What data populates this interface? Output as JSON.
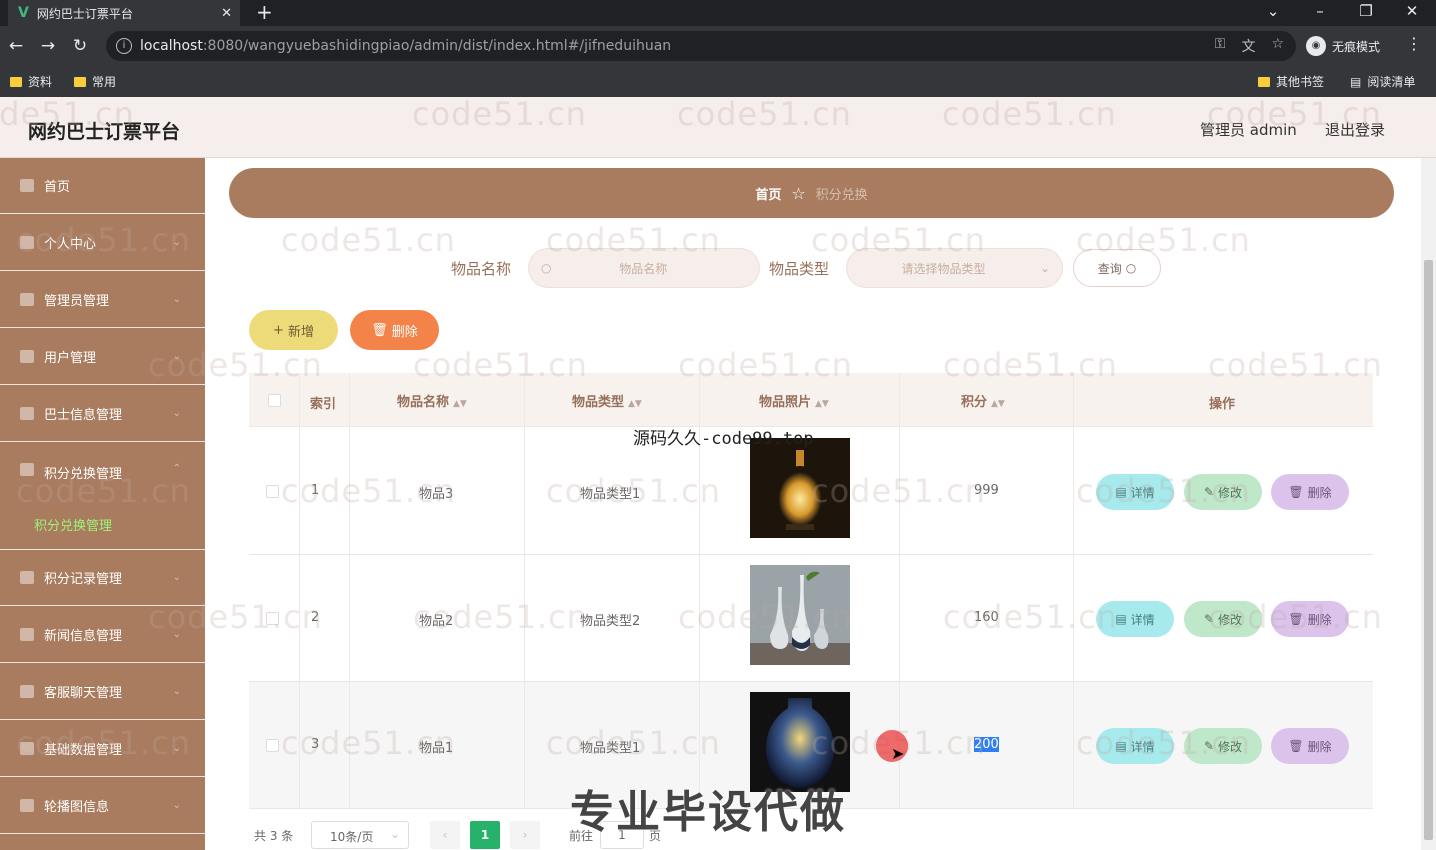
{
  "browser": {
    "tab_title": "网约巴士订票平台",
    "url_host": "localhost",
    "url_path": ":8080/wangyuebashidingpiao/admin/dist/index.html#/jifneduihuan",
    "incognito_label": "无痕模式",
    "bookmarks": [
      "资料",
      "常用"
    ],
    "other_bookmarks": "其他书签",
    "reading_list": "阅读清单"
  },
  "header": {
    "title": "网约巴士订票平台",
    "admin": "管理员 admin",
    "logout": "退出登录"
  },
  "sidebar": {
    "items": [
      {
        "label": "首页"
      },
      {
        "label": "个人中心"
      },
      {
        "label": "管理员管理"
      },
      {
        "label": "用户管理"
      },
      {
        "label": "巴士信息管理"
      },
      {
        "label": "积分兑换管理"
      },
      {
        "label": "积分记录管理"
      },
      {
        "label": "新闻信息管理"
      },
      {
        "label": "客服聊天管理"
      },
      {
        "label": "基础数据管理"
      },
      {
        "label": "轮播图信息"
      }
    ],
    "active_sub": "积分兑换管理"
  },
  "breadcrumb": {
    "home": "首页",
    "current": "积分兑换"
  },
  "search": {
    "name_label": "物品名称",
    "name_placeholder": "物品名称",
    "type_label": "物品类型",
    "type_placeholder": "请选择物品类型",
    "query_button": "查询"
  },
  "actions": {
    "add": "新增",
    "delete": "删除"
  },
  "table": {
    "headers": {
      "index": "索引",
      "name": "物品名称",
      "type": "物品类型",
      "photo": "物品照片",
      "points": "积分",
      "ops": "操作"
    },
    "rows": [
      {
        "index": "1",
        "name": "物品3",
        "type": "物品类型1",
        "points": "999"
      },
      {
        "index": "2",
        "name": "物品2",
        "type": "物品类型2",
        "points": "160"
      },
      {
        "index": "3",
        "name": "物品1",
        "type": "物品类型1",
        "points": "200"
      }
    ],
    "op_labels": {
      "detail": "详情",
      "edit": "修改",
      "delete": "删除"
    }
  },
  "pagination": {
    "total": "共 3 条",
    "page_size": "10条/页",
    "current": "1",
    "goto_prefix": "前往",
    "goto_value": "1",
    "goto_suffix": "页"
  },
  "overlays": {
    "watermark": "code51.cn",
    "promo_top": "源码久久-code99.top",
    "promo_bottom": "专业毕设代做"
  },
  "colors": {
    "brand": "#a97c5f",
    "header_bg": "#f5eeec",
    "active_page": "#26b26b"
  }
}
